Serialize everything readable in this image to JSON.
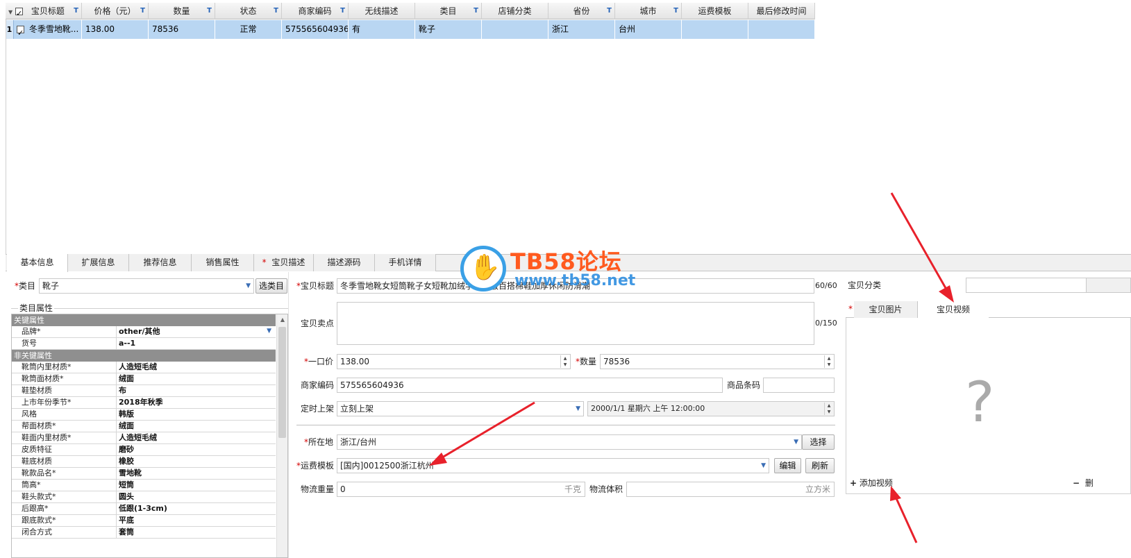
{
  "grid": {
    "columns": [
      {
        "label": "宝贝标题",
        "filter": true
      },
      {
        "label": "价格（元）",
        "filter": true
      },
      {
        "label": "数量",
        "filter": true
      },
      {
        "label": "状态",
        "filter": true
      },
      {
        "label": "商家编码",
        "filter": true
      },
      {
        "label": "无线描述",
        "filter": false
      },
      {
        "label": "类目",
        "filter": true
      },
      {
        "label": "店铺分类",
        "filter": false
      },
      {
        "label": "省份",
        "filter": true
      },
      {
        "label": "城市",
        "filter": true
      },
      {
        "label": "运费模板",
        "filter": false
      },
      {
        "label": "最后修改时间",
        "filter": false
      }
    ],
    "filter_glyph": "T",
    "row": {
      "num": "1",
      "title": "冬季雪地靴...",
      "price": "138.00",
      "qty": "78536",
      "status": "正常",
      "code": "575565604936",
      "mobile_desc": "有",
      "category": "靴子",
      "shop_cat": "",
      "province": "浙江",
      "city": "台州",
      "freight": "",
      "modified": ""
    }
  },
  "tabs": [
    {
      "label": "基本信息"
    },
    {
      "label": "扩展信息"
    },
    {
      "label": "推荐信息"
    },
    {
      "label": "销售属性"
    },
    {
      "label": "宝贝描述"
    },
    {
      "label": "描述源码"
    },
    {
      "label": "手机详情"
    }
  ],
  "left": {
    "category_label": "类目",
    "category_value": "靴子",
    "select_button": "选类目",
    "attr_section": "类目属性",
    "group_key": "关键属性",
    "group_nonkey": "非关键属性",
    "key_attrs": [
      {
        "name": "品牌*",
        "value": "other/其他"
      },
      {
        "name": "货号",
        "value": "a--1"
      }
    ],
    "nonkey_attrs": [
      {
        "name": "靴筒内里材质*",
        "value": "人造短毛绒"
      },
      {
        "name": "靴筒面材质*",
        "value": "绒面"
      },
      {
        "name": "鞋垫材质",
        "value": "布"
      },
      {
        "name": "上市年份季节*",
        "value": "2018年秋季"
      },
      {
        "name": "风格",
        "value": "韩版"
      },
      {
        "name": "帮面材质*",
        "value": "绒面"
      },
      {
        "name": "鞋面内里材质*",
        "value": "人造短毛绒"
      },
      {
        "name": "皮质特征",
        "value": "磨砂"
      },
      {
        "name": "鞋底材质",
        "value": "橡胶"
      },
      {
        "name": "靴款品名*",
        "value": "雪地靴"
      },
      {
        "name": "筒高*",
        "value": "短筒"
      },
      {
        "name": "鞋头款式*",
        "value": "圆头"
      },
      {
        "name": "后跟高*",
        "value": "低跟(1-3cm)"
      },
      {
        "name": "跟底款式*",
        "value": "平底"
      },
      {
        "name": "闭合方式",
        "value": "套筒"
      }
    ]
  },
  "form": {
    "title_label": "宝贝标题",
    "title_value": "冬季雪地靴女短筒靴子女短靴加绒学生韩版百搭棉鞋加厚休闲防滑潮",
    "title_count": "60/60",
    "selling_label": "宝贝卖点",
    "selling_count": "0/150",
    "price_label": "一口价",
    "price_value": "138.00",
    "qty_label": "数量",
    "qty_value": "78536",
    "code_label": "商家编码",
    "code_value": "575565604936",
    "barcode_label": "商品条码",
    "barcode_value": "",
    "schedule_label": "定时上架",
    "schedule_value": "立刻上架",
    "schedule_time": "2000/1/1 星期六 上午 12:00:00",
    "location_label": "所在地",
    "location_value": "浙江/台州",
    "location_button": "选择",
    "freight_label": "运费模板",
    "freight_value": "[国内]0012500浙江杭州",
    "edit_button": "编辑",
    "refresh_button": "刷新",
    "weight_label": "物流重量",
    "weight_value": "0",
    "weight_unit": "千克",
    "volume_label": "物流体积",
    "volume_value": "",
    "volume_unit": "立方米",
    "required_mark": "*"
  },
  "right": {
    "shop_cat_label": "宝贝分类",
    "tab_images": "宝贝图片",
    "tab_video": "宝贝视频",
    "placeholder_glyph": "?",
    "add_video": "添加视频",
    "delete_glyph": "删"
  },
  "watermark": {
    "logo_text": "TB58论坛",
    "url": "www.tb58.net"
  },
  "colors": {
    "selected_row": "#b9d6f2",
    "required": "#d40000",
    "filter_icon": "#2563b8",
    "arrow": "#e8212b"
  }
}
